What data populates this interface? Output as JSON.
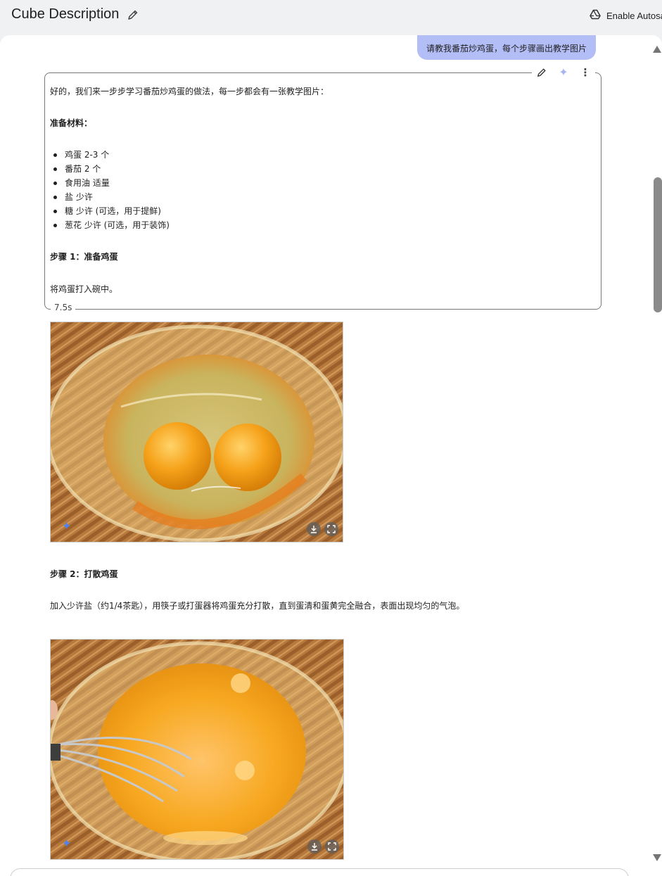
{
  "header": {
    "title": "Cube Description",
    "autosave_label": "Enable Autosa"
  },
  "chat": {
    "user_message": "请教我番茄炒鸡蛋，每个步骤画出教学图片",
    "response_intro": "好的，我们来一步步学习番茄炒鸡蛋的做法，每一步都会有一张教学图片：",
    "ingredients_heading": "准备材料：",
    "ingredients": [
      "鸡蛋 2-3 个",
      "番茄 2 个",
      "食用油 适量",
      "盐 少许",
      "糖 少许 (可选，用于提鲜)",
      "葱花 少许 (可选，用于装饰)"
    ],
    "step1_heading": "步骤 1：准备鸡蛋",
    "step1_text": "将鸡蛋打入碗中。",
    "elapsed": "7.5s",
    "step2_heading": "步骤 2：打散鸡蛋",
    "step2_text": "加入少许盐（约1/4茶匙），用筷子或打蛋器将鸡蛋充分打散，直到蛋清和蛋黄完全融合，表面出现均匀的气泡。"
  },
  "icons": {
    "title_edit": "pencil-icon",
    "autosave": "drive-icon",
    "edit": "pencil-icon",
    "rerun": "sparkle-icon",
    "more": "more-vert-icon",
    "image_badge": "gemini-sparkle-icon",
    "download": "download-icon",
    "fullscreen": "fullscreen-icon"
  },
  "colors": {
    "user_bubble": "#b3bef7",
    "page_bg": "#f0f1f3",
    "panel_bg": "#ffffff",
    "sparkle_blue": "#4d82f0"
  }
}
